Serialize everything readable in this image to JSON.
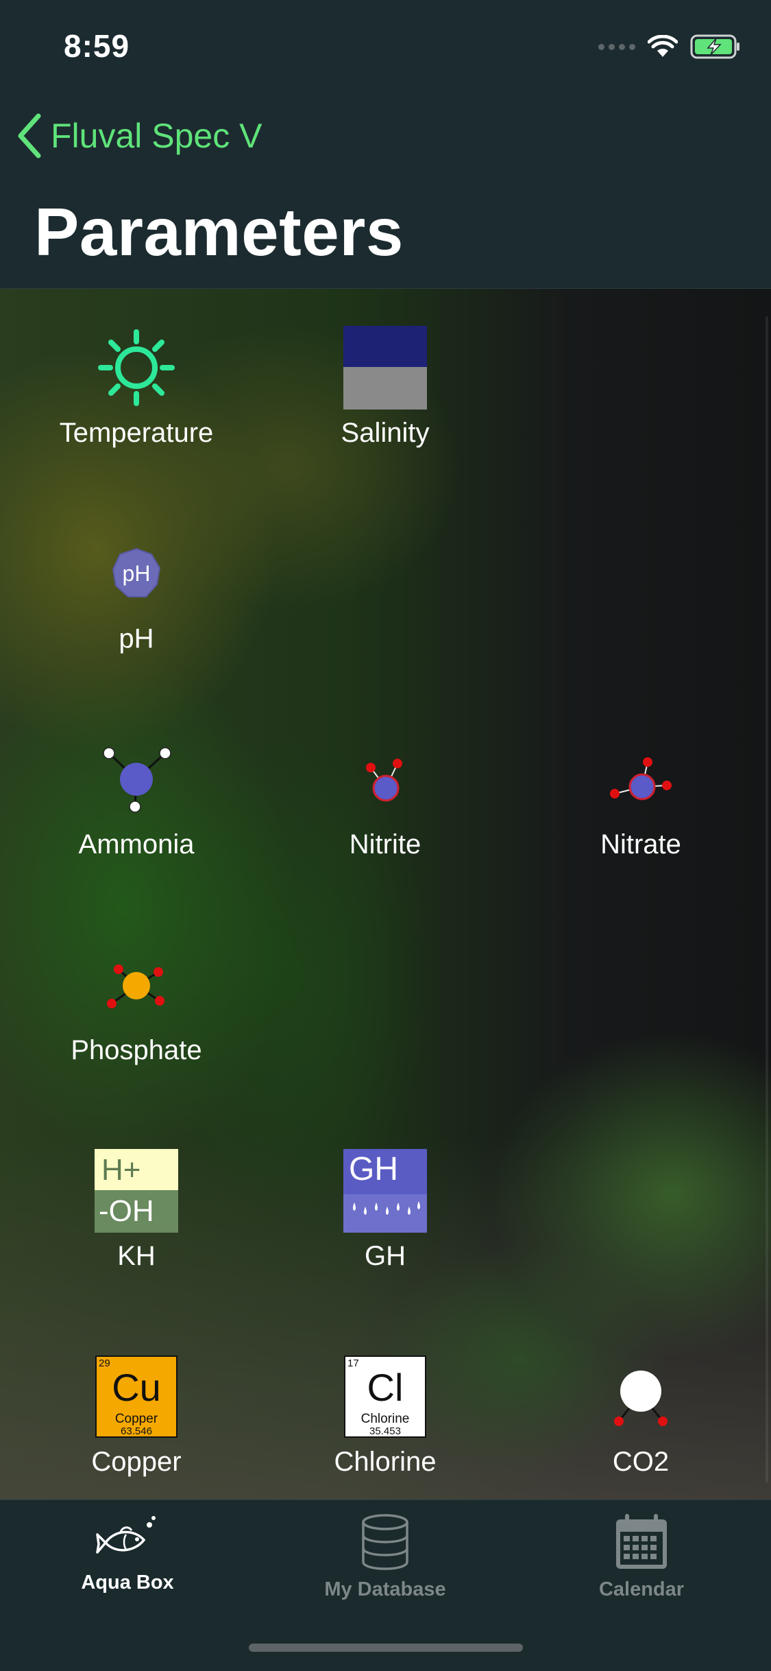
{
  "status_bar": {
    "time": "8:59",
    "icons": [
      "cellular-signal-icon",
      "wifi-icon",
      "battery-charging-icon"
    ]
  },
  "nav": {
    "back_label": "Fluval Spec V",
    "title": "Parameters"
  },
  "colors": {
    "accent": "#5fe37a",
    "background": "#1c2b2f",
    "tab_active": "#ffffff",
    "tab_inactive": "#7d8789"
  },
  "parameters": [
    {
      "label": "Temperature",
      "icon": "sun-icon"
    },
    {
      "label": "Salinity",
      "icon": "salinity-icon"
    },
    {
      "label": "pH",
      "icon": "ph-icon",
      "text": "pH"
    },
    {
      "label": "Ammonia",
      "icon": "ammonia-molecule-icon"
    },
    {
      "label": "Nitrite",
      "icon": "nitrite-molecule-icon"
    },
    {
      "label": "Nitrate",
      "icon": "nitrate-molecule-icon"
    },
    {
      "label": "Phosphate",
      "icon": "phosphate-molecule-icon"
    },
    {
      "label": "KH",
      "icon": "kh-icon",
      "top_text": "H+",
      "bottom_text": "-OH"
    },
    {
      "label": "GH",
      "icon": "gh-icon",
      "text": "GH"
    },
    {
      "label": "Copper",
      "icon": "copper-element-icon",
      "number": "29",
      "symbol": "Cu",
      "name": "Copper",
      "mass": "63.546"
    },
    {
      "label": "Chlorine",
      "icon": "chlorine-element-icon",
      "number": "17",
      "symbol": "Cl",
      "name": "Chlorine",
      "mass": "35.453"
    },
    {
      "label": "CO2",
      "icon": "co2-molecule-icon"
    }
  ],
  "tabs": [
    {
      "label": "Aqua Box",
      "icon": "fish-icon",
      "active": true
    },
    {
      "label": "My Database",
      "icon": "database-icon",
      "active": false
    },
    {
      "label": "Calendar",
      "icon": "calendar-icon",
      "active": false
    }
  ]
}
